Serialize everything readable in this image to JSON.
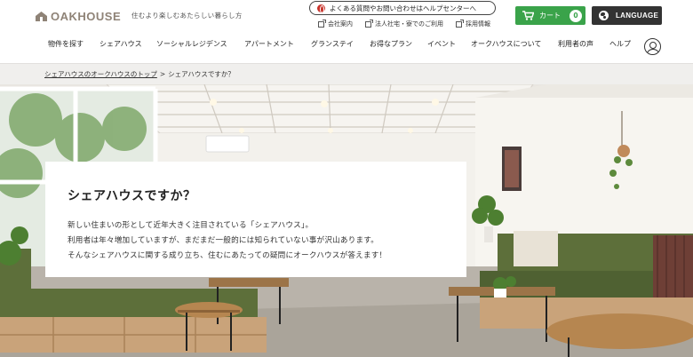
{
  "brand": {
    "logo_text": "OAKHOUSE",
    "tagline": "住むより楽しむあたらしい暮らし方"
  },
  "header": {
    "help_center_label": "よくある質問やお問い合わせはヘルプセンターへ",
    "sublinks": [
      {
        "label": "会社案内"
      },
      {
        "label": "法人社宅・寮でのご利用"
      },
      {
        "label": "採用情報"
      }
    ],
    "cart": {
      "label": "カート",
      "count": "0"
    },
    "language_label": "LANGUAGE"
  },
  "nav": {
    "items": [
      {
        "label": "物件を探す"
      },
      {
        "label": "シェアハウス"
      },
      {
        "label": "ソーシャルレジデンス"
      },
      {
        "label": "アパートメント"
      },
      {
        "label": "グランステイ"
      },
      {
        "label": "お得なプラン"
      },
      {
        "label": "イベント"
      },
      {
        "label": "オークハウスについて"
      },
      {
        "label": "利用者の声"
      },
      {
        "label": "ヘルプ"
      }
    ]
  },
  "breadcrumb": {
    "link": "シェアハウスのオークハウスのトップ",
    "separator": ">",
    "current": "シェアハウスですか？"
  },
  "intro": {
    "title": "シェアハウスですか？",
    "lines": [
      "新しい住まいの形として近年大きく注目されている「シェアハウス」。",
      "利用者は年々増加していますが、まだまだ一般的には知られていない事が沢山あります。",
      "そんなシェアハウスに関する成り立ち、住むにあたっての疑問にオークハウスが答えます！"
    ]
  },
  "colors": {
    "logo": "#8f8377",
    "cart": "#3aa34a",
    "language": "#333333",
    "breadcrumb_bg": "#f0efed",
    "sofa": "#5d6f3a",
    "wood": "#c9a37a"
  }
}
